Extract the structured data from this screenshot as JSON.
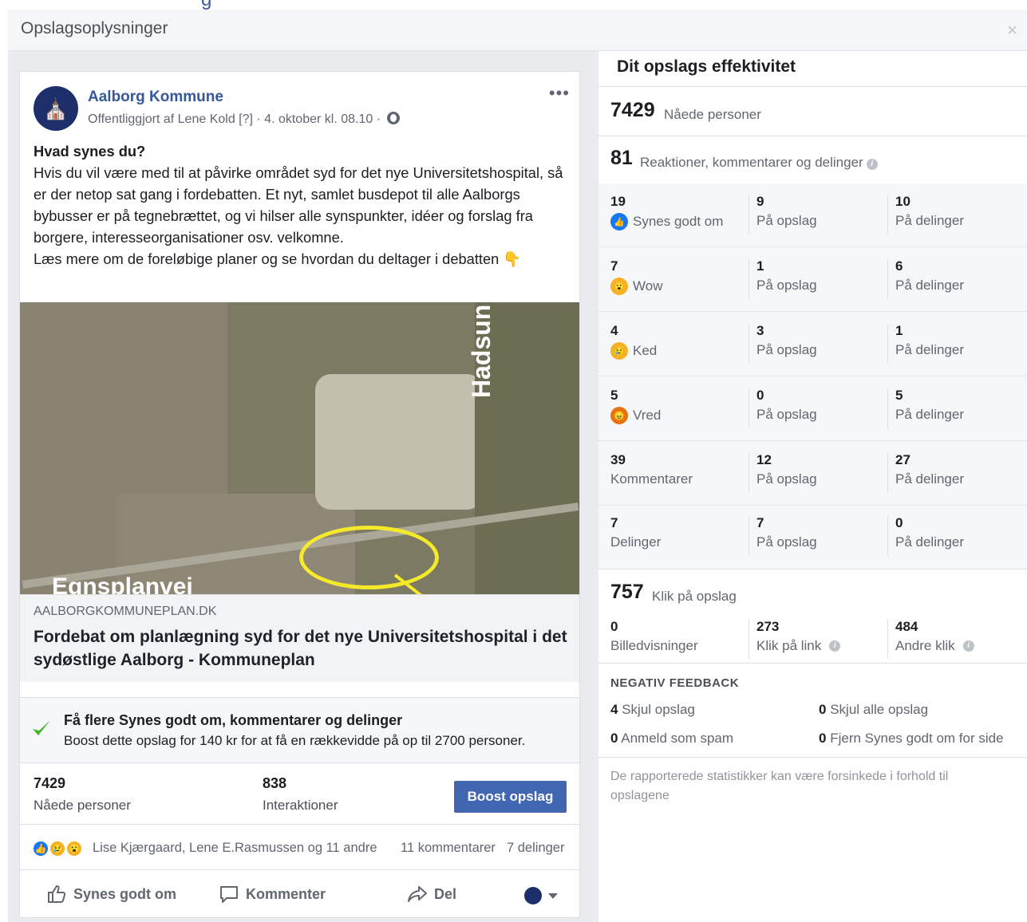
{
  "dialog": {
    "title": "Opslagsoplysninger",
    "close": "×"
  },
  "post": {
    "page_name": "Aalborg Kommune",
    "meta": "Offentliggjort af Lene Kold [?] · 4. oktober kl. 08.10 ·",
    "more": "•••",
    "text_lead": "Hvad synes du?",
    "text_body": "Hvis du vil være med til at påvirke området syd for det nye Universitetshospital, så er der netop sat gang i fordebatten. Et nyt, samlet busdepot til alle Aalborgs bybusser er på tegnebrættet, og vi hilser alle synspunkter, idéer og forslag fra borgere, interesseorganisationer osv. velkomne.",
    "text_cta": "Læs mere om de foreløbige planer og se hvordan du deltager i debatten 👇",
    "map_labels": {
      "road_right": "Hadsun",
      "road_bottom": "Egnsplanvej"
    },
    "link": {
      "domain": "AALBORGKOMMUNEPLAN.DK",
      "title": "Fordebat om planlægning syd for det nye Universitetshospital i det sydøstlige Aalborg - Kommuneplan"
    },
    "boost": {
      "title": "Få flere Synes godt om, kommentarer og delinger",
      "desc": "Boost dette opslag for 140 kr for at få en rækkevidde på op til 2700 personer."
    },
    "stats": {
      "reach_num": "7429",
      "reach_label": "Nåede personer",
      "inter_num": "838",
      "inter_label": "Interaktioner",
      "boost_button": "Boost opslag"
    },
    "social": {
      "names": "Lise Kjærgaard, Lene E.Rasmussen og 11 andre",
      "comments": "11 kommentarer",
      "shares": "7 delinger"
    },
    "actions": {
      "like": "Synes godt om",
      "comment": "Kommenter",
      "share": "Del"
    }
  },
  "performance": {
    "title": "Dit opslags effektivitet",
    "reach_num": "7429",
    "reach_label": "Nåede personer",
    "engage_num": "81",
    "engage_label": "Reaktioner, kommentarer og delinger",
    "rows": [
      {
        "total": "19",
        "label": "Synes godt om",
        "icon": "like-icon",
        "on_post": "9",
        "on_post_label": "På opslag",
        "on_shares": "10",
        "on_shares_label": "På delinger"
      },
      {
        "total": "7",
        "label": "Wow",
        "icon": "wow-icon",
        "on_post": "1",
        "on_post_label": "På opslag",
        "on_shares": "6",
        "on_shares_label": "På delinger"
      },
      {
        "total": "4",
        "label": "Ked",
        "icon": "sad-icon",
        "on_post": "3",
        "on_post_label": "På opslag",
        "on_shares": "1",
        "on_shares_label": "På delinger"
      },
      {
        "total": "5",
        "label": "Vred",
        "icon": "angry-icon",
        "on_post": "0",
        "on_post_label": "På opslag",
        "on_shares": "5",
        "on_shares_label": "På delinger"
      },
      {
        "total": "39",
        "label": "Kommentarer",
        "icon": "",
        "on_post": "12",
        "on_post_label": "På opslag",
        "on_shares": "27",
        "on_shares_label": "På delinger"
      },
      {
        "total": "7",
        "label": "Delinger",
        "icon": "",
        "on_post": "7",
        "on_post_label": "På opslag",
        "on_shares": "0",
        "on_shares_label": "På delinger"
      }
    ],
    "clicks_num": "757",
    "clicks_label": "Klik på opslag",
    "clicks": [
      {
        "num": "0",
        "label": "Billedvisninger"
      },
      {
        "num": "273",
        "label": "Klik på link"
      },
      {
        "num": "484",
        "label": "Andre klik"
      }
    ],
    "negative": {
      "title": "NEGATIV FEEDBACK",
      "hide_num": "4",
      "hide_label": "Skjul opslag",
      "hide_all_num": "0",
      "hide_all_label": "Skjul alle opslag",
      "spam_num": "0",
      "spam_label": "Anmeld som spam",
      "unlike_num": "0",
      "unlike_label": "Fjern Synes godt om for side"
    },
    "footnote": "De rapporterede statistikker kan være forsinkede i forhold til opslagene"
  },
  "colors": {
    "brand": "#4267b2",
    "link": "#365899",
    "bg": "#e9ebee"
  }
}
